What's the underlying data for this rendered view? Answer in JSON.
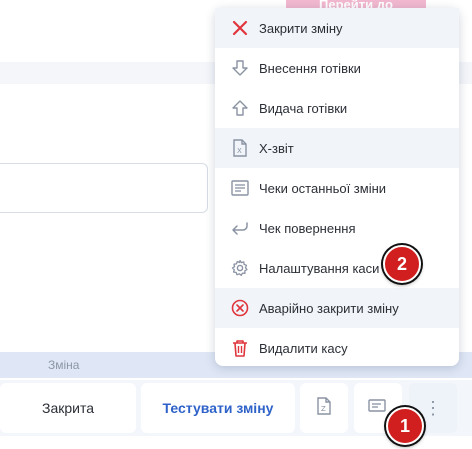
{
  "top_badge": "Перейти до реєстрацій",
  "table": {
    "column_header": "Зміна",
    "row": {
      "status": "Закрита",
      "test_shift_button": "Тестувати зміну",
      "z_icon": "z-report-icon",
      "receipt_icon": "receipt-icon",
      "more_icon": "kebab-menu-icon"
    }
  },
  "menu": {
    "items": [
      {
        "label": "Закрити зміну",
        "icon": "close-x-icon"
      },
      {
        "label": "Внесення готівки",
        "icon": "arrow-down-icon"
      },
      {
        "label": "Видача готівки",
        "icon": "arrow-up-icon"
      },
      {
        "label": "Х-звіт",
        "icon": "x-report-icon"
      },
      {
        "label": "Чеки останньої зміни",
        "icon": "receipts-list-icon"
      },
      {
        "label": "Чек повернення",
        "icon": "return-arrow-icon"
      },
      {
        "label": "Налаштування каси",
        "icon": "gear-icon"
      },
      {
        "label": "Аварійно закрити зміну",
        "icon": "emergency-close-icon"
      },
      {
        "label": "Видалити касу",
        "icon": "trash-icon"
      }
    ]
  },
  "markers": {
    "step1": "1",
    "step2": "2"
  },
  "colors": {
    "accent_blue": "#2e62c9",
    "danger_red": "#e0353d",
    "marker_red": "#d11f1f"
  }
}
